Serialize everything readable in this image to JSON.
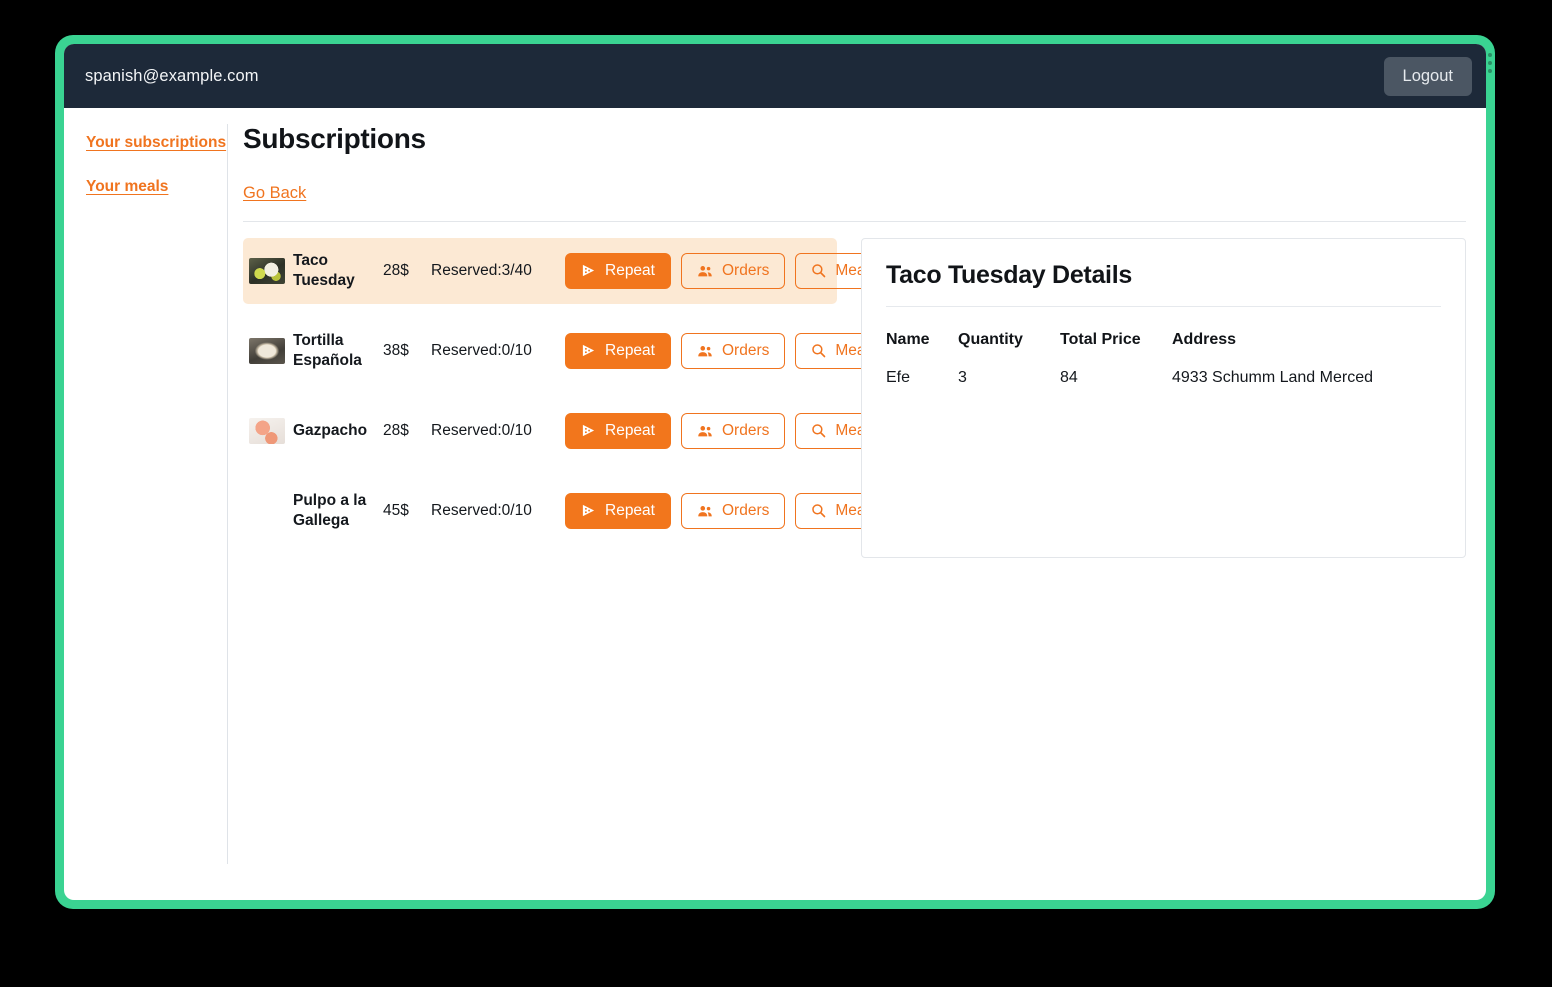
{
  "topbar": {
    "email": "spanish@example.com",
    "logout_label": "Logout"
  },
  "sidebar": {
    "items": [
      {
        "label": "Your subscriptions",
        "name": "your-subscriptions"
      },
      {
        "label": "Your meals",
        "name": "your-meals"
      }
    ]
  },
  "main": {
    "page_title": "Subscriptions",
    "go_back_label": "Go Back"
  },
  "buttons": {
    "repeat_label": "Repeat",
    "orders_label": "Orders",
    "meal_label": "Meal"
  },
  "subscriptions": [
    {
      "name": "Taco Tuesday",
      "price": "28$",
      "reserved": "Reserved:3/40",
      "thumb_class": "taco",
      "selected": true
    },
    {
      "name": "Tortilla Española",
      "price": "38$",
      "reserved": "Reserved:0/10",
      "thumb_class": "tortilla",
      "selected": false
    },
    {
      "name": "Gazpacho",
      "price": "28$",
      "reserved": "Reserved:0/10",
      "thumb_class": "gazpacho",
      "selected": false
    },
    {
      "name": "Pulpo a la Gallega",
      "price": "45$",
      "reserved": "Reserved:0/10",
      "thumb_class": "pulpo",
      "selected": false
    }
  ],
  "detail": {
    "title": "Taco Tuesday Details",
    "columns": [
      "Name",
      "Quantity",
      "Total Price",
      "Address"
    ],
    "rows": [
      {
        "name": "Efe",
        "quantity": "3",
        "total_price": "84",
        "address": "4933 Schumm Land Merced"
      }
    ]
  },
  "colors": {
    "frame_green": "#3ad392",
    "topbar_dark": "#1d2939",
    "accent_orange": "#f0741f",
    "primary_orange": "#f2761c",
    "highlight_row": "#fce9d4",
    "logout_gray": "#4b5663"
  }
}
